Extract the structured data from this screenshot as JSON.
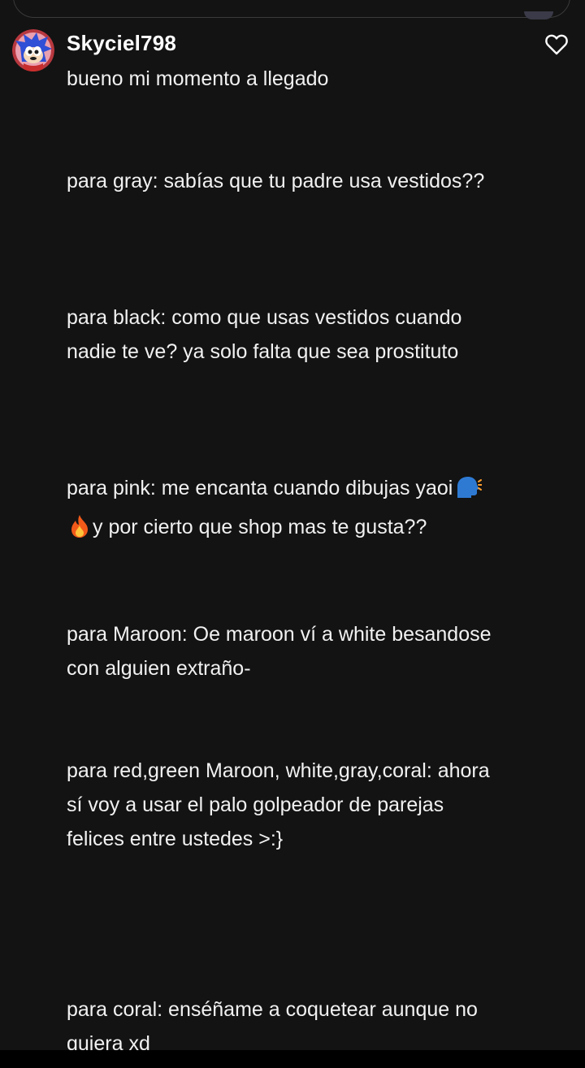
{
  "comment": {
    "author": "Skyciel798",
    "paragraphs": [
      {
        "lines": [
          "bueno mi momento a llegado"
        ],
        "gap_after": 84
      },
      {
        "lines": [
          "para gray: sabías que tu padre usa vestidos??"
        ],
        "gap_after": 126
      },
      {
        "lines": [
          "para black: como que usas vestidos cuando",
          "nadie te ve? ya solo falta que sea prostituto"
        ],
        "gap_after": 126
      },
      {
        "lines": [
          "para pink: me encanta cuando dibujas yaoi",
          "y por cierto que shop mas te gusta??"
        ],
        "gap_after": 84
      },
      {
        "lines": [
          "para Maroon: Oe maroon ví a white besandose",
          "con alguien extraño-"
        ],
        "gap_after": 84
      },
      {
        "lines": [
          "para red,green Maroon, white,gray,coral: ahora",
          "sí voy a usar el palo golpeador de parejas",
          "felices entre ustedes >:}"
        ],
        "gap_after": 168
      },
      {
        "lines": [
          "para coral: enséñame a coquetear aunque no",
          "quiera xd"
        ],
        "gap_after": 0
      }
    ],
    "emojis": {
      "speaking_head": "speaking-head-icon",
      "fire": "fire-icon"
    }
  }
}
